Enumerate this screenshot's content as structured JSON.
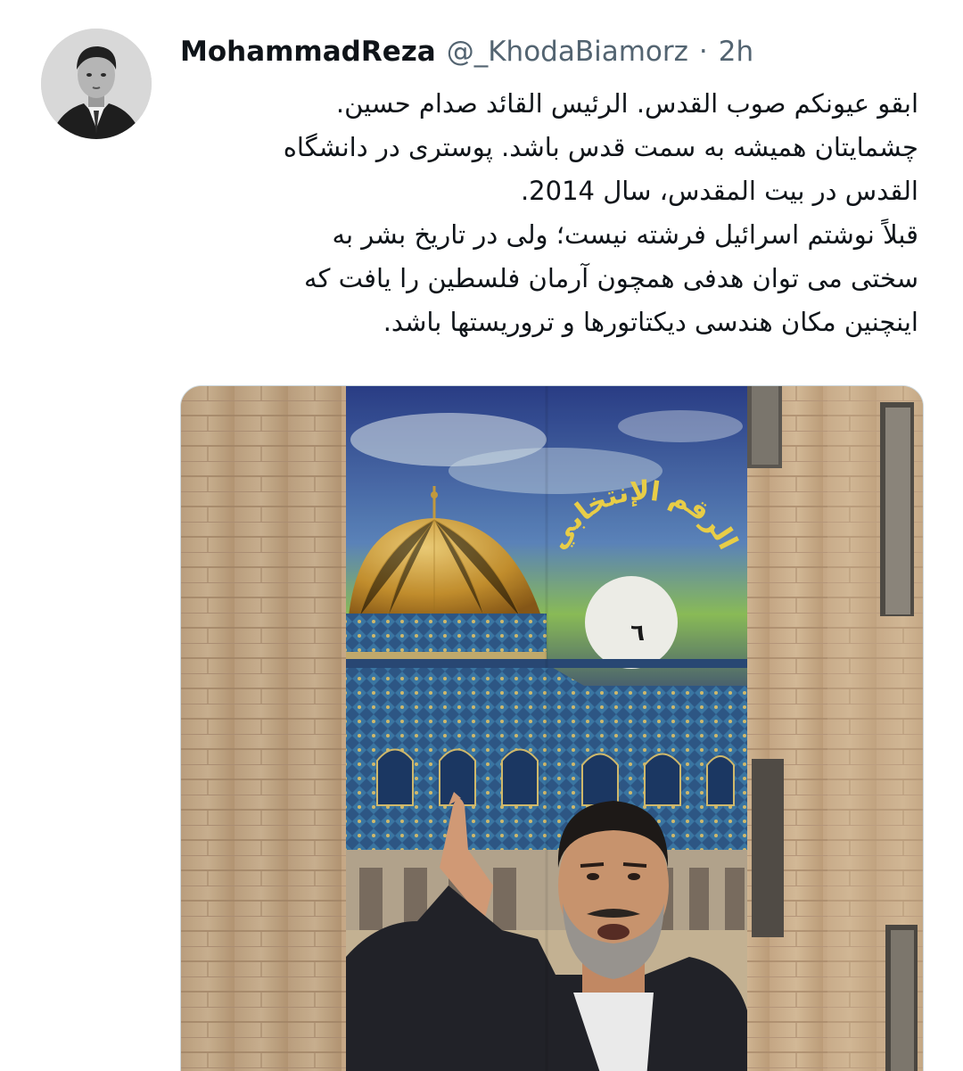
{
  "author": {
    "display_name": "MohammadReza",
    "handle": "@_KhodaBiamorz",
    "separator": "·",
    "timestamp": "2h",
    "avatar_icon": "portrait-avatar"
  },
  "tweet": {
    "lines": [
      "ابقو عیونکم صوب القدس. الرئیس القائد صدام حسین.",
      "چشمایتان همیشه به سمت قدس باشد. پوستری در دانشگاه",
      "القدس در بیت المقدس، سال 2014.",
      "قبلاً نوشتم اسرائیل فرشته نیست؛ ولی در تاریخ بشر به",
      "سختی می توان هدفی همچون آرمان فلسطین را یافت که",
      "اینچنین مکان هندسی دیکتاتورها و تروریستها باشد."
    ]
  },
  "media": {
    "poster_arabic_text": "الرقم الإنتخابي",
    "poster_number": "٦"
  },
  "colors": {
    "text": "#0f1419",
    "secondary": "#536471",
    "border": "#cfd9de"
  }
}
